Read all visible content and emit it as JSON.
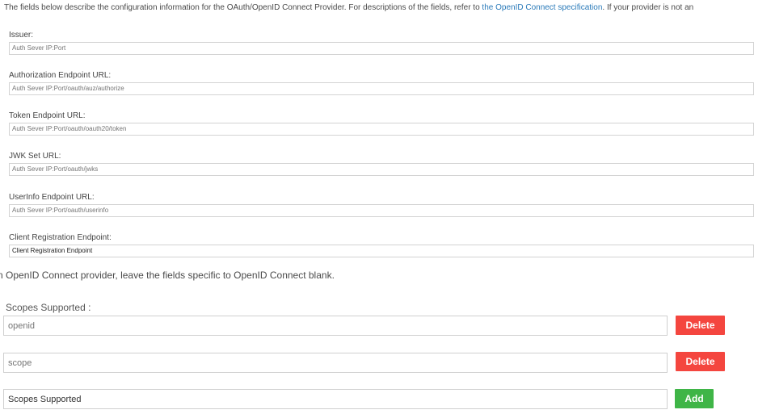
{
  "intro": {
    "text_before": "The fields below describe the configuration information for the OAuth/OpenID Connect Provider. For descriptions of the fields, refer to ",
    "link_text": "the OpenID Connect specification",
    "text_after": ". If your provider is not an",
    "continuation": "n OpenID Connect provider, leave the fields specific to OpenID Connect blank."
  },
  "fields": [
    {
      "label": "Issuer:",
      "value": "",
      "placeholder": "Auth Sever IP:Port"
    },
    {
      "label": "Authorization Endpoint URL:",
      "value": "",
      "placeholder": "Auth Sever IP:Port/oauth/auz/authorize"
    },
    {
      "label": "Token Endpoint URL:",
      "value": "",
      "placeholder": "Auth Sever IP:Port/oauth/oauth20/token"
    },
    {
      "label": "JWK Set URL:",
      "value": "",
      "placeholder": "Auth Sever IP:Port/oauth/jwks"
    },
    {
      "label": "UserInfo Endpoint URL:",
      "value": "",
      "placeholder": "Auth Sever IP:Port/oauth/userinfo"
    },
    {
      "label": "Client Registration Endpoint:",
      "value": "Client Registration Endpoint",
      "placeholder": ""
    }
  ],
  "scopes": {
    "label": "Scopes Supported :",
    "items": [
      {
        "value": "",
        "placeholder": "openid",
        "button": "Delete"
      },
      {
        "value": "",
        "placeholder": "scope",
        "button": "Delete"
      }
    ],
    "new_item": {
      "value": "Scopes Supported",
      "button": "Add"
    }
  },
  "colors": {
    "link": "#2a7ab9",
    "delete_button": "#f4463f",
    "add_button": "#3fb547"
  }
}
